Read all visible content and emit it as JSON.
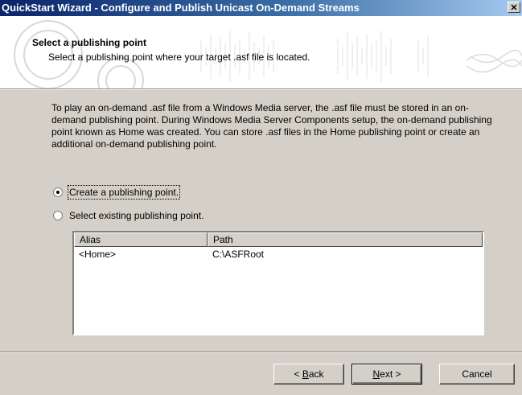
{
  "window": {
    "title": "QuickStart Wizard - Configure and Publish Unicast On-Demand Streams",
    "close_glyph": "✕"
  },
  "header": {
    "title": "Select a publishing point",
    "subtitle": "Select a publishing point where your target .asf file is located."
  },
  "intro_text": "To play an on-demand .asf file from a Windows Media server, the .asf file must be stored in an on-demand publishing point.  During Windows Media Server Components setup, the on-demand publishing point known as Home was created. You can store .asf files in the Home publishing point or create an additional on-demand publishing point.",
  "options": {
    "create": {
      "label": "Create a publishing point.",
      "checked": true
    },
    "existing": {
      "label": "Select existing publishing point.",
      "checked": false
    }
  },
  "list": {
    "columns": [
      "Alias",
      "Path"
    ],
    "rows": [
      {
        "alias": "<Home>",
        "path": "C:\\ASFRoot"
      }
    ]
  },
  "buttons": {
    "back": {
      "prefix": "< ",
      "accel": "B",
      "rest": "ack"
    },
    "next": {
      "accel": "N",
      "rest": "ext >"
    },
    "cancel": "Cancel"
  }
}
